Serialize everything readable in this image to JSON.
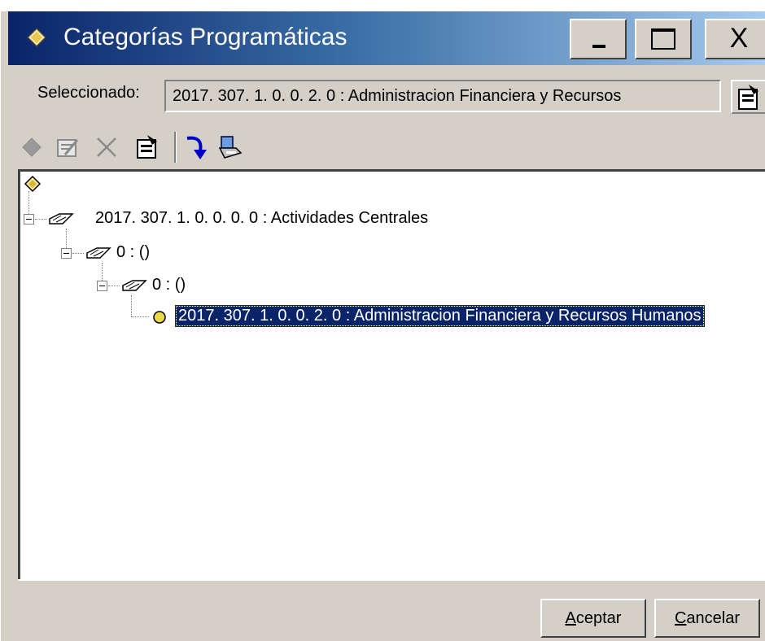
{
  "window": {
    "title": "Categorías Programáticas",
    "minimize_glyph": "_",
    "maximize_glyph": "□",
    "close_glyph": "X",
    "title_icon": "diamond-folder-icon"
  },
  "selection": {
    "label": "Seleccionado:",
    "value": "2017. 307. 1. 0. 0. 2. 0 : Administracion Financiera y Recursos"
  },
  "toolbar": {
    "icons": [
      "new-node-icon",
      "edit-icon",
      "delete-icon",
      "properties-icon",
      "move-down-icon",
      "print-icon"
    ]
  },
  "tree": {
    "nodes": [
      {
        "label": "",
        "icon": "root-icon",
        "level": 0
      },
      {
        "label": "2017. 307. 1. 0. 0. 0. 0 : Actividades Centrales",
        "icon": "open-book-icon",
        "level": 1
      },
      {
        "label": "0 : ()",
        "icon": "open-book-icon",
        "level": 2
      },
      {
        "label": "0 : ()",
        "icon": "open-book-icon",
        "level": 3
      },
      {
        "label": "2017. 307. 1. 0. 0. 2. 0 : Administracion Financiera y Recursos Humanos",
        "icon": "leaf-dot-icon",
        "level": 4,
        "selected": true
      }
    ]
  },
  "buttons": {
    "ok_mnemonic": "A",
    "ok_rest": "ceptar",
    "cancel_mnemonic": "C",
    "cancel_rest": "ancelar"
  },
  "colors": {
    "title_start": "#0a246a",
    "title_end": "#a6caf0",
    "selection_bg": "#0a246a",
    "face": "#d4d0c8"
  }
}
